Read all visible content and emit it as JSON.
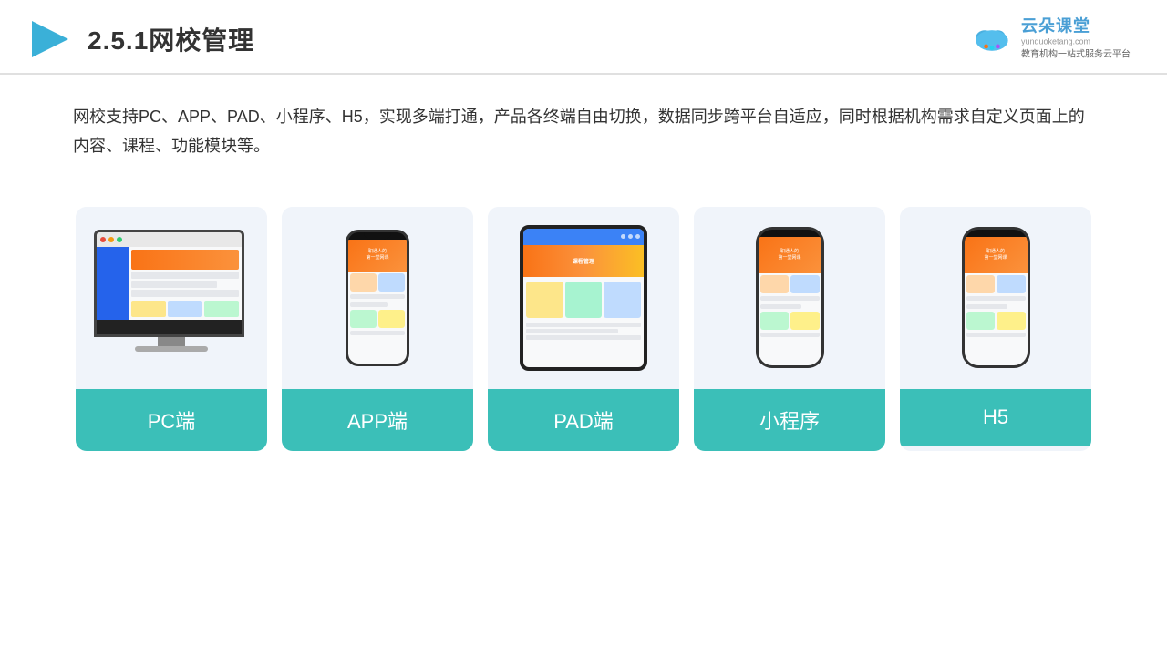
{
  "header": {
    "title": "2.5.1网校管理",
    "brand": {
      "name": "云朵课堂",
      "url": "yunduoketang.com",
      "tagline": "教育机构一站式服务云平台"
    }
  },
  "description": "网校支持PC、APP、PAD、小程序、H5，实现多端打通，产品各终端自由切换，数据同步跨平台自适应，同时根据机构需求自定义页面上的内容、课程、功能模块等。",
  "cards": [
    {
      "id": "pc",
      "label": "PC端"
    },
    {
      "id": "app",
      "label": "APP端"
    },
    {
      "id": "pad",
      "label": "PAD端"
    },
    {
      "id": "mini",
      "label": "小程序"
    },
    {
      "id": "h5",
      "label": "H5"
    }
  ],
  "accent_color": "#3bbfb8"
}
